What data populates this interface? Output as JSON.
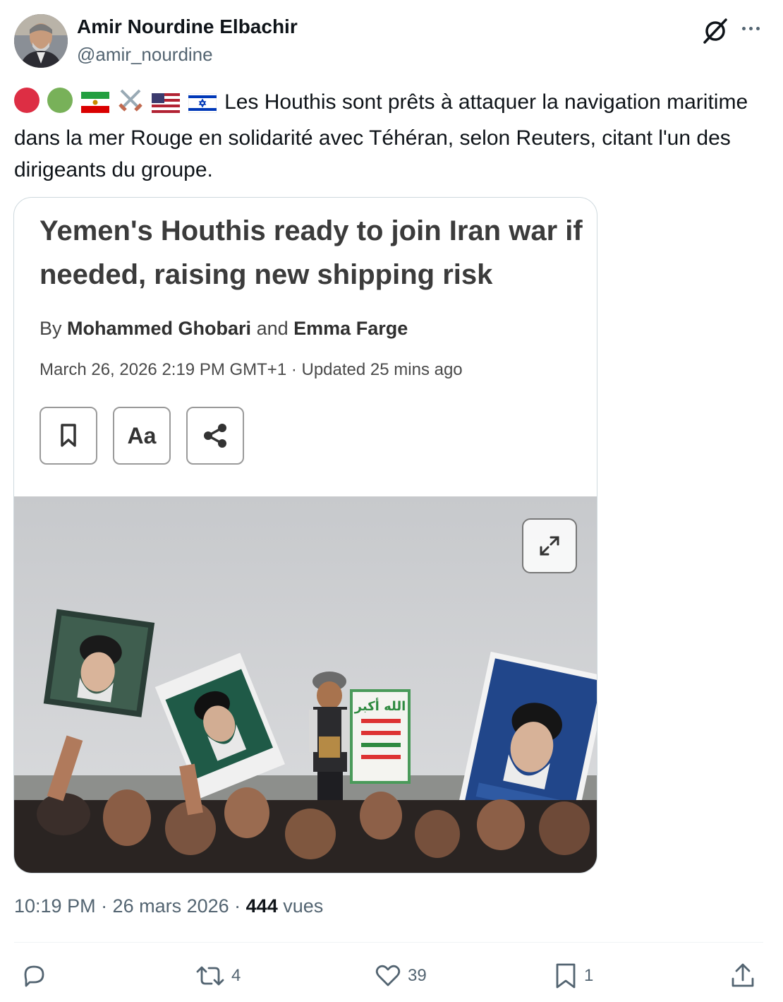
{
  "author": {
    "name": "Amir Nourdine Elbachir",
    "handle": "@amir_nourdine",
    "avatar_icon": "avatar-photo"
  },
  "tweet": {
    "emojis": [
      "red-circle",
      "green-circle",
      "iran-flag",
      "crossed-swords",
      "us-flag",
      "israel-flag"
    ],
    "text": "Les Houthis sont prêts à attaquer la navigation maritime dans la mer Rouge en solidarité avec Téhéran, selon Reuters, citant l'un des dirigeants du groupe."
  },
  "article": {
    "headline": "Yemen's Houthis ready to join Iran war if needed, raising new shipping risk",
    "by": "By",
    "author1": "Mohammed Ghobari",
    "and": "and",
    "author2": "Emma Farge",
    "dateline": "March 26, 2026 2:19 PM GMT+1 · Updated 25 mins ago",
    "aa_label": "Aa",
    "sign_text": "الله أكبر"
  },
  "meta": {
    "time": "10:19 PM · 26 mars 2026 · ",
    "views": "444",
    "views_label": " vues"
  },
  "actions": {
    "reply_count": "",
    "retweet_count": "4",
    "like_count": "39",
    "bookmark_count": "1"
  },
  "colors": {
    "text": "#0f1419",
    "secondary": "#536471",
    "border": "#cfd9de",
    "red_circle": "#dd2e44",
    "green_circle": "#78b159"
  }
}
